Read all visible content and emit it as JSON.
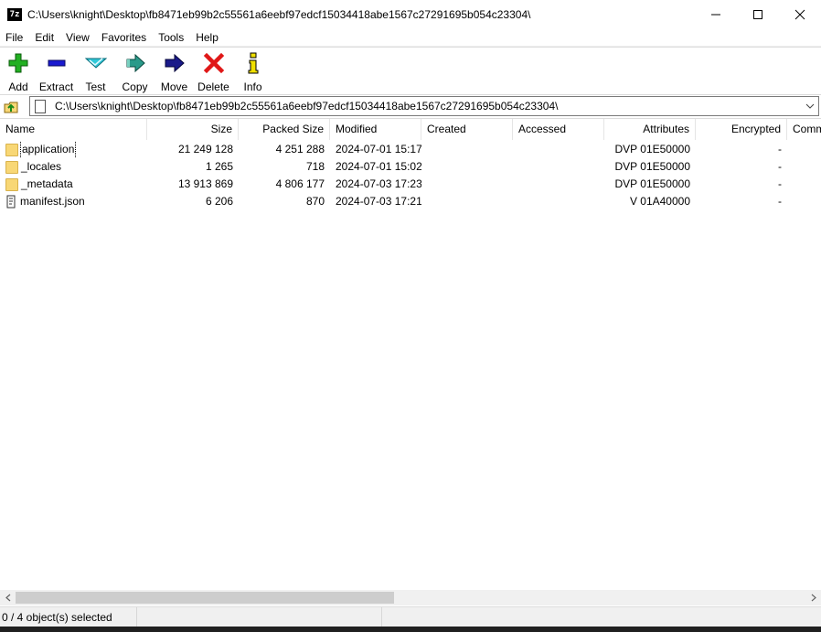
{
  "window": {
    "app_icon_text": "7z",
    "title": "C:\\Users\\knight\\Desktop\\fb8471eb99b2c55561a6eebf97edcf15034418abe1567c27291695b054c23304\\"
  },
  "menu": [
    "File",
    "Edit",
    "View",
    "Favorites",
    "Tools",
    "Help"
  ],
  "toolbar": [
    {
      "label": "Add",
      "icon": "plus-icon",
      "color": "#1aa01a"
    },
    {
      "label": "Extract",
      "icon": "minus-icon",
      "color": "#1a1ad0"
    },
    {
      "label": "Test",
      "icon": "check-icon",
      "color": "#1ab8c8"
    },
    {
      "label": "Copy",
      "icon": "copy-arrow-icon",
      "color": "#2a8a8a"
    },
    {
      "label": "Move",
      "icon": "move-arrow-icon",
      "color": "#1a1a9a"
    },
    {
      "label": "Delete",
      "icon": "delete-x-icon",
      "color": "#e01a1a"
    },
    {
      "label": "Info",
      "icon": "info-icon",
      "color": "#e8d000"
    }
  ],
  "address": {
    "path": "C:\\Users\\knight\\Desktop\\fb8471eb99b2c55561a6eebf97edcf15034418abe1567c27291695b054c23304\\"
  },
  "columns": [
    "Name",
    "Size",
    "Packed Size",
    "Modified",
    "Created",
    "Accessed",
    "Attributes",
    "Encrypted",
    "Comm"
  ],
  "rows": [
    {
      "name": "application",
      "type": "folder",
      "size": "21 249 128",
      "packed": "4 251 288",
      "modified": "2024-07-01 15:17",
      "created": "",
      "accessed": "",
      "attributes": "DVP 01E50000",
      "encrypted": "-"
    },
    {
      "name": "_locales",
      "type": "folder",
      "size": "1 265",
      "packed": "718",
      "modified": "2024-07-01 15:02",
      "created": "",
      "accessed": "",
      "attributes": "DVP 01E50000",
      "encrypted": "-"
    },
    {
      "name": "_metadata",
      "type": "folder",
      "size": "13 913 869",
      "packed": "4 806 177",
      "modified": "2024-07-03 17:23",
      "created": "",
      "accessed": "",
      "attributes": "DVP 01E50000",
      "encrypted": "-"
    },
    {
      "name": "manifest.json",
      "type": "file",
      "size": "6 206",
      "packed": "870",
      "modified": "2024-07-03 17:21",
      "created": "",
      "accessed": "",
      "attributes": "V 01A40000",
      "encrypted": "-"
    }
  ],
  "status": {
    "selection": "0 / 4 object(s) selected",
    "section2": "",
    "section3": ""
  }
}
